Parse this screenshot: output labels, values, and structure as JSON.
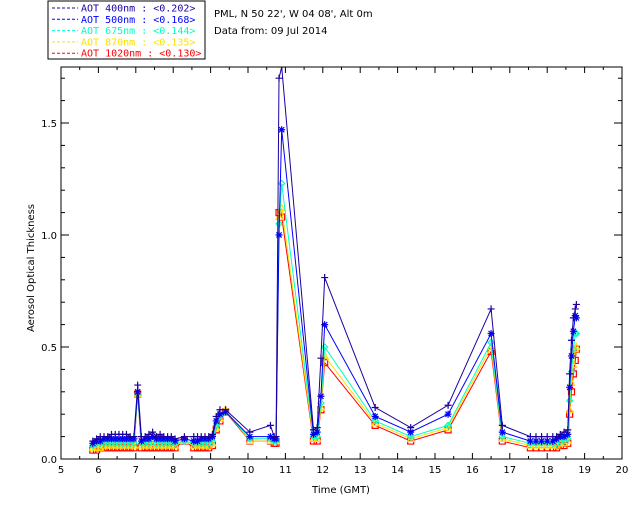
{
  "chart_data": {
    "type": "line",
    "info_lines": [
      "PML, N 50 22', W 04 08', Alt 0m",
      "Data from: 09 Jul 2014"
    ],
    "xlabel": "Time (GMT)",
    "ylabel": "Aerosol Optical Thickness",
    "xlim": [
      5,
      20
    ],
    "ylim": [
      0,
      1.75
    ],
    "x_ticks": [
      5,
      6,
      7,
      8,
      9,
      10,
      11,
      12,
      13,
      14,
      15,
      16,
      17,
      18,
      19,
      20
    ],
    "y_ticks": [
      0.0,
      0.5,
      1.0,
      1.5
    ],
    "legend_position": "top-left",
    "grid": false,
    "x": [
      5.85,
      5.95,
      6.05,
      6.15,
      6.25,
      6.35,
      6.45,
      6.55,
      6.65,
      6.75,
      6.85,
      6.95,
      7.05,
      7.15,
      7.25,
      7.35,
      7.45,
      7.55,
      7.65,
      7.75,
      7.85,
      7.95,
      8.05,
      8.3,
      8.55,
      8.65,
      8.75,
      8.85,
      8.95,
      9.05,
      9.15,
      9.25,
      9.4,
      10.05,
      10.6,
      10.7,
      10.75,
      10.83,
      10.9,
      11.75,
      11.85,
      11.95,
      12.05,
      13.4,
      14.35,
      15.35,
      16.5,
      16.8,
      17.55,
      17.7,
      17.85,
      18.0,
      18.15,
      18.25,
      18.35,
      18.45,
      18.55,
      18.6,
      18.65,
      18.7,
      18.75,
      18.78
    ],
    "series": [
      {
        "name": "AOT  400nm",
        "mean": "<0.202>",
        "color": "#1d009f",
        "values": [
          0.08,
          0.09,
          0.1,
          0.1,
          0.1,
          0.11,
          0.11,
          0.11,
          0.11,
          0.11,
          0.1,
          0.1,
          0.33,
          0.1,
          0.1,
          0.11,
          0.12,
          0.1,
          0.11,
          0.1,
          0.1,
          0.1,
          0.09,
          0.1,
          0.1,
          0.1,
          0.1,
          0.1,
          0.1,
          0.11,
          0.19,
          0.22,
          0.22,
          0.12,
          0.15,
          0.1,
          0.1,
          1.7,
          1.75,
          0.13,
          0.14,
          0.45,
          0.81,
          0.23,
          0.14,
          0.24,
          0.67,
          0.15,
          0.1,
          0.1,
          0.1,
          0.1,
          0.1,
          0.1,
          0.11,
          0.12,
          0.13,
          0.38,
          0.53,
          0.63,
          0.67,
          0.69
        ]
      },
      {
        "name": "AOT  500nm",
        "mean": "<0.168>",
        "color": "#0000ff",
        "values": [
          0.07,
          0.08,
          0.08,
          0.09,
          0.09,
          0.09,
          0.09,
          0.09,
          0.09,
          0.09,
          0.09,
          0.09,
          0.3,
          0.08,
          0.09,
          0.09,
          0.1,
          0.09,
          0.09,
          0.09,
          0.09,
          0.09,
          0.08,
          0.09,
          0.08,
          0.08,
          0.09,
          0.09,
          0.09,
          0.1,
          0.17,
          0.2,
          0.21,
          0.1,
          0.1,
          0.09,
          0.09,
          1.0,
          1.47,
          0.11,
          0.12,
          0.28,
          0.6,
          0.19,
          0.12,
          0.2,
          0.56,
          0.12,
          0.08,
          0.08,
          0.08,
          0.08,
          0.08,
          0.09,
          0.1,
          0.1,
          0.11,
          0.32,
          0.46,
          0.57,
          0.64,
          0.63
        ]
      },
      {
        "name": "AOT  675nm",
        "mean": "<0.144>",
        "color": "#00ffc4",
        "values": [
          0.06,
          0.07,
          0.07,
          0.07,
          0.07,
          0.07,
          0.07,
          0.07,
          0.07,
          0.07,
          0.07,
          0.07,
          0.29,
          0.07,
          0.07,
          0.07,
          0.08,
          0.07,
          0.07,
          0.07,
          0.07,
          0.07,
          0.07,
          0.08,
          0.07,
          0.07,
          0.07,
          0.07,
          0.07,
          0.08,
          0.15,
          0.19,
          0.21,
          0.09,
          0.09,
          0.08,
          0.08,
          1.05,
          1.23,
          0.1,
          0.1,
          0.25,
          0.5,
          0.17,
          0.1,
          0.15,
          0.52,
          0.1,
          0.07,
          0.07,
          0.07,
          0.07,
          0.07,
          0.07,
          0.08,
          0.08,
          0.09,
          0.26,
          0.39,
          0.49,
          0.56,
          0.56
        ]
      },
      {
        "name": "AOT  870nm",
        "mean": "<0.135>",
        "color": "#ffe000",
        "values": [
          0.05,
          0.05,
          0.05,
          0.06,
          0.06,
          0.06,
          0.06,
          0.06,
          0.06,
          0.06,
          0.06,
          0.06,
          0.29,
          0.06,
          0.06,
          0.06,
          0.06,
          0.06,
          0.06,
          0.06,
          0.06,
          0.06,
          0.06,
          0.08,
          0.06,
          0.06,
          0.06,
          0.06,
          0.06,
          0.07,
          0.14,
          0.18,
          0.22,
          0.08,
          0.08,
          0.08,
          0.08,
          1.08,
          1.12,
          0.09,
          0.09,
          0.23,
          0.46,
          0.16,
          0.09,
          0.14,
          0.5,
          0.09,
          0.06,
          0.06,
          0.06,
          0.06,
          0.06,
          0.06,
          0.07,
          0.07,
          0.08,
          0.22,
          0.34,
          0.42,
          0.49,
          0.5
        ]
      },
      {
        "name": "AOT 1020nm",
        "mean": "<0.130>",
        "color": "#ff0000",
        "values": [
          0.04,
          0.04,
          0.05,
          0.05,
          0.05,
          0.05,
          0.05,
          0.05,
          0.05,
          0.05,
          0.05,
          0.05,
          0.29,
          0.05,
          0.05,
          0.05,
          0.05,
          0.05,
          0.05,
          0.05,
          0.05,
          0.05,
          0.05,
          0.08,
          0.05,
          0.05,
          0.05,
          0.05,
          0.05,
          0.06,
          0.13,
          0.17,
          0.21,
          0.08,
          0.08,
          0.07,
          0.07,
          1.1,
          1.08,
          0.08,
          0.08,
          0.22,
          0.43,
          0.15,
          0.08,
          0.13,
          0.48,
          0.08,
          0.05,
          0.05,
          0.05,
          0.05,
          0.05,
          0.05,
          0.06,
          0.06,
          0.07,
          0.2,
          0.3,
          0.38,
          0.44,
          0.49
        ]
      }
    ]
  }
}
